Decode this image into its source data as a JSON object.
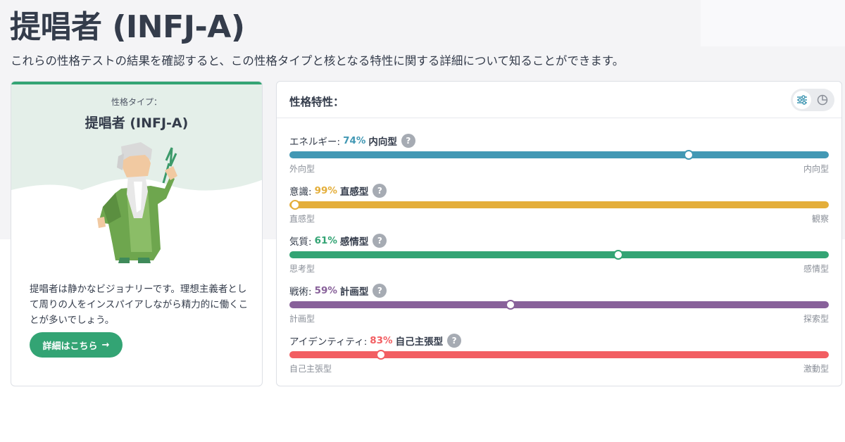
{
  "page": {
    "title": "提唱者 (INFJ-A)",
    "subtitle": "これらの性格テストの結果を確認すると、この性格タイプと核となる特性に関する詳細について知ることができます。"
  },
  "type_card": {
    "label": "性格タイプ：",
    "name": "提唱者 (INFJ-A)",
    "description": "提唱者は静かなビジョナリーです。理想主義者として周りの人をインスパイアしながら精力的に働くことが多いでしょう。",
    "button_label": "詳細はこちら",
    "button_arrow": "→",
    "illustration_icon": "advocate-avatar-icon",
    "accent_color": "#33a474"
  },
  "traits_card": {
    "title": "性格特性：",
    "view_icons": [
      "sliders-icon",
      "pie-chart-icon"
    ],
    "traits": [
      {
        "name": "エネルギー:",
        "percent": "74%",
        "type": "内向型",
        "left": "外向型",
        "right": "内向型",
        "color": "#4298b4",
        "position": 0.74,
        "help": "?"
      },
      {
        "name": "意識:",
        "percent": "99%",
        "type": "直感型",
        "left": "直感型",
        "right": "観察",
        "color": "#e4ae3a",
        "position": 0.01,
        "help": "?"
      },
      {
        "name": "気質:",
        "percent": "61%",
        "type": "感情型",
        "left": "思考型",
        "right": "感情型",
        "color": "#33a474",
        "position": 0.61,
        "help": "?"
      },
      {
        "name": "戦術:",
        "percent": "59%",
        "type": "計画型",
        "left": "計画型",
        "right": "探索型",
        "color": "#88619a",
        "position": 0.41,
        "help": "?"
      },
      {
        "name": "アイデンティティ:",
        "percent": "83%",
        "type": "自己主張型",
        "left": "自己主張型",
        "right": "激動型",
        "color": "#f25e62",
        "position": 0.17,
        "help": "?"
      }
    ]
  }
}
